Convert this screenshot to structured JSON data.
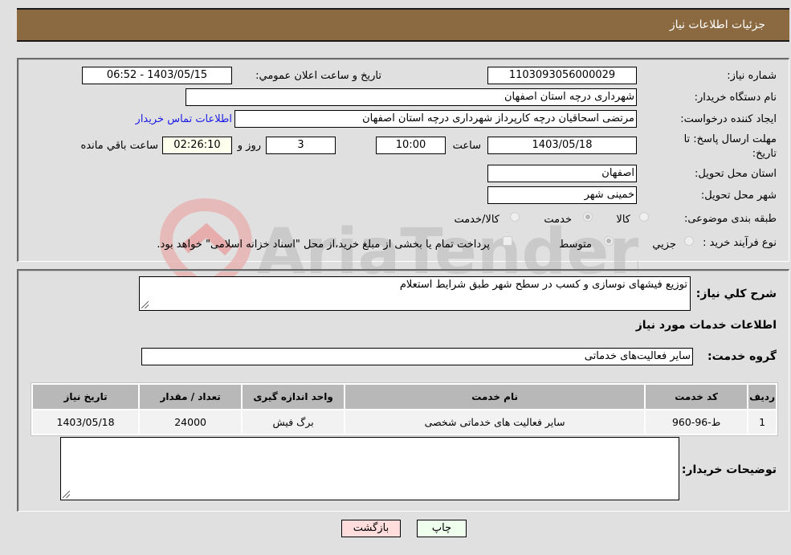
{
  "header": {
    "title": "جزئیات اطلاعات نیاز"
  },
  "form": {
    "need_number": {
      "label": "شماره نیاز:",
      "value": "1103093056000029"
    },
    "announce_datetime": {
      "label": "تاریخ و ساعت اعلان عمومي:",
      "value": "1403/05/15 - 06:52"
    },
    "buyer_org": {
      "label": "نام دستگاه خريدار:",
      "value": "شهرداری درچه استان اصفهان"
    },
    "requester": {
      "label": "ايجاد کننده درخواست:",
      "value": "مرتضی اسحاقیان درچه کارپرداز شهرداری درچه استان اصفهان"
    },
    "buyer_contact_link": "اطلاعات تماس خريدار",
    "deadline": {
      "label": "مهلت ارسال پاسخ: تا تاریخ:",
      "date": "1403/05/18",
      "time_label": "ساعت",
      "time": "10:00",
      "days": "3",
      "days_label": "روز و",
      "remaining": "02:26:10",
      "remaining_label": "ساعت باقي مانده"
    },
    "delivery_province": {
      "label": "استان محل تحويل:",
      "value": "اصفهان"
    },
    "delivery_city": {
      "label": "شهر محل تحويل:",
      "value": "خمینی شهر"
    },
    "category": {
      "label": "طبقه بندی موضوعی:",
      "options": [
        "کالا",
        "خدمت",
        "کالا/خدمت"
      ],
      "selected": "خدمت"
    },
    "purchase_type": {
      "label": "نوع فرآيند خريد :",
      "options": [
        "جزيي",
        "متوسط"
      ],
      "selected": "متوسط",
      "treasury_note": "پرداخت تمام يا بخشی از مبلغ خريد،از محل \"اسناد خزانه اسلامی\" خواهد بود."
    }
  },
  "details": {
    "description_label": "شرح کلي نياز:",
    "description_value": "توزیع فیشهای نوسازی و کسب در سطح  شهر طبق شرایط استعلام",
    "services_heading": "اطلاعات خدمات مورد نياز",
    "service_group_label": "گروه خدمت:",
    "service_group_value": "سایر فعالیت‌های خدماتی",
    "table": {
      "headers": [
        "رديف",
        "کد خدمت",
        "نام خدمت",
        "واحد اندازه گيری",
        "تعداد / مقدار",
        "تاريخ نياز"
      ],
      "rows": [
        [
          "1",
          "ط-96-960",
          "سایر فعالیت های خدماتی شخصی",
          "برگ فیش",
          "24000",
          "1403/05/18"
        ]
      ]
    },
    "buyer_notes_label": "توضيحات خريدار:",
    "buyer_notes_value": ""
  },
  "buttons": {
    "print": "چاپ",
    "back": "بازگشت"
  },
  "watermark": "AriaTender.neT",
  "colors": {
    "header_bg": "#8b6a41",
    "print_bg": "#eeffee",
    "back_bg": "#ffdddd",
    "link": "#1a1ae6"
  }
}
